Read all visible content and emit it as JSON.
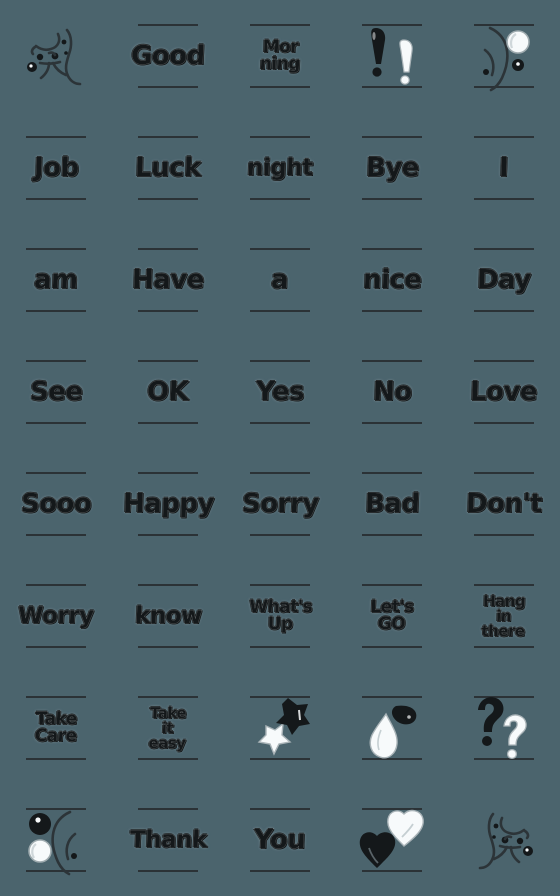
{
  "meta": {
    "title": "Emoji Sticker Pack Preview",
    "background_color": "#4b646d",
    "ink_color": "#14181a",
    "outline_color": "#dfe4e6",
    "rule_color": "#2b3236",
    "columns": 5,
    "rows": 8,
    "total_cells": 40
  },
  "cells": [
    {
      "index": 1,
      "row": 1,
      "col": 1,
      "kind": "art",
      "art": "doodle-face-left",
      "label": ""
    },
    {
      "index": 2,
      "row": 1,
      "col": 2,
      "kind": "word",
      "size": "big",
      "label": "Good"
    },
    {
      "index": 3,
      "row": 1,
      "col": 3,
      "kind": "word",
      "size": "multi",
      "label": "Mor\nning"
    },
    {
      "index": 4,
      "row": 1,
      "col": 4,
      "kind": "art",
      "art": "double-exclamation",
      "label": "!!"
    },
    {
      "index": 5,
      "row": 1,
      "col": 5,
      "kind": "art",
      "art": "crescent-bubbles",
      "label": ""
    },
    {
      "index": 6,
      "row": 2,
      "col": 1,
      "kind": "word",
      "size": "big",
      "label": "Job"
    },
    {
      "index": 7,
      "row": 2,
      "col": 2,
      "kind": "word",
      "size": "big",
      "label": "Luck"
    },
    {
      "index": 8,
      "row": 2,
      "col": 3,
      "kind": "word",
      "size": "",
      "label": "night"
    },
    {
      "index": 9,
      "row": 2,
      "col": 4,
      "kind": "word",
      "size": "big",
      "label": "Bye"
    },
    {
      "index": 10,
      "row": 2,
      "col": 5,
      "kind": "word",
      "size": "big",
      "label": "I"
    },
    {
      "index": 11,
      "row": 3,
      "col": 1,
      "kind": "word",
      "size": "big",
      "label": "am"
    },
    {
      "index": 12,
      "row": 3,
      "col": 2,
      "kind": "word",
      "size": "big",
      "label": "Have"
    },
    {
      "index": 13,
      "row": 3,
      "col": 3,
      "kind": "word",
      "size": "big",
      "label": "a"
    },
    {
      "index": 14,
      "row": 3,
      "col": 4,
      "kind": "word",
      "size": "big",
      "label": "nice"
    },
    {
      "index": 15,
      "row": 3,
      "col": 5,
      "kind": "word",
      "size": "big",
      "label": "Day"
    },
    {
      "index": 16,
      "row": 4,
      "col": 1,
      "kind": "word",
      "size": "big",
      "label": "See"
    },
    {
      "index": 17,
      "row": 4,
      "col": 2,
      "kind": "word",
      "size": "big",
      "label": "OK"
    },
    {
      "index": 18,
      "row": 4,
      "col": 3,
      "kind": "word",
      "size": "big",
      "label": "Yes"
    },
    {
      "index": 19,
      "row": 4,
      "col": 4,
      "kind": "word",
      "size": "big",
      "label": "No"
    },
    {
      "index": 20,
      "row": 4,
      "col": 5,
      "kind": "word",
      "size": "big",
      "label": "Love"
    },
    {
      "index": 21,
      "row": 5,
      "col": 1,
      "kind": "word",
      "size": "big",
      "label": "Sooo"
    },
    {
      "index": 22,
      "row": 5,
      "col": 2,
      "kind": "word",
      "size": "big",
      "label": "Happy"
    },
    {
      "index": 23,
      "row": 5,
      "col": 3,
      "kind": "word",
      "size": "big",
      "label": "Sorry"
    },
    {
      "index": 24,
      "row": 5,
      "col": 4,
      "kind": "word",
      "size": "big",
      "label": "Bad"
    },
    {
      "index": 25,
      "row": 5,
      "col": 5,
      "kind": "word",
      "size": "big",
      "label": "Don't"
    },
    {
      "index": 26,
      "row": 6,
      "col": 1,
      "kind": "word",
      "size": "",
      "label": "Worry"
    },
    {
      "index": 27,
      "row": 6,
      "col": 2,
      "kind": "word",
      "size": "",
      "label": "know"
    },
    {
      "index": 28,
      "row": 6,
      "col": 3,
      "kind": "word",
      "size": "multi",
      "label": "What's\nUp"
    },
    {
      "index": 29,
      "row": 6,
      "col": 4,
      "kind": "word",
      "size": "multi",
      "label": "Let's\nGO"
    },
    {
      "index": 30,
      "row": 6,
      "col": 5,
      "kind": "word",
      "size": "tri",
      "label": "Hang\nin\nthere"
    },
    {
      "index": 31,
      "row": 7,
      "col": 1,
      "kind": "word",
      "size": "multi",
      "label": "Take\nCare"
    },
    {
      "index": 32,
      "row": 7,
      "col": 2,
      "kind": "word",
      "size": "tri",
      "label": "Take\nit\neasy"
    },
    {
      "index": 33,
      "row": 7,
      "col": 3,
      "kind": "art",
      "art": "two-stars",
      "label": ""
    },
    {
      "index": 34,
      "row": 7,
      "col": 4,
      "kind": "art",
      "art": "two-sweat-drops",
      "label": ""
    },
    {
      "index": 35,
      "row": 7,
      "col": 5,
      "kind": "art",
      "art": "two-question-marks",
      "label": "??"
    },
    {
      "index": 36,
      "row": 8,
      "col": 1,
      "kind": "art",
      "art": "crescent-bubbles-flip",
      "label": ""
    },
    {
      "index": 37,
      "row": 8,
      "col": 2,
      "kind": "word",
      "size": "",
      "label": "Thank"
    },
    {
      "index": 38,
      "row": 8,
      "col": 3,
      "kind": "word",
      "size": "big",
      "label": "You"
    },
    {
      "index": 39,
      "row": 8,
      "col": 4,
      "kind": "art",
      "art": "two-hearts",
      "label": ""
    },
    {
      "index": 40,
      "row": 8,
      "col": 5,
      "kind": "art",
      "art": "doodle-face-right",
      "label": ""
    }
  ]
}
